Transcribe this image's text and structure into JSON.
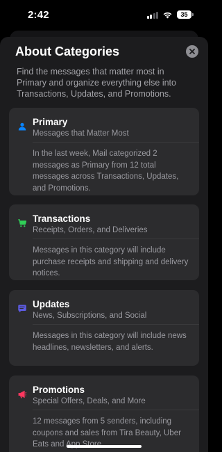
{
  "status_bar": {
    "time": "2:42",
    "battery_level": "35"
  },
  "sheet": {
    "title": "About Categories",
    "intro": "Find the messages that matter most in Primary and organize everything else into Transactions, Updates, and Promotions."
  },
  "categories": [
    {
      "title": "Primary",
      "subtitle": "Messages that Matter Most",
      "description": "In the last week, Mail categorized 2 messages as Primary from 12 total messages across Transactions, Updates, and Promotions.",
      "icon": "person-icon",
      "color": "#0a84ff"
    },
    {
      "title": "Transactions",
      "subtitle": "Receipts, Orders, and Deliveries",
      "description": "Messages in this category will include purchase receipts and shipping and delivery notices.",
      "icon": "cart-icon",
      "color": "#30d158"
    },
    {
      "title": "Updates",
      "subtitle": "News, Subscriptions, and Social",
      "description": "Messages in this category will include news headlines, newsletters, and alerts.",
      "icon": "message-bubble-icon",
      "color": "#5e5ce6"
    },
    {
      "title": "Promotions",
      "subtitle": "Special Offers, Deals, and More",
      "description": "12 messages from 5 senders, including coupons and sales from Tira Beauty, Uber Eats and App Store.",
      "icon": "megaphone-icon",
      "color": "#ff375f"
    }
  ]
}
